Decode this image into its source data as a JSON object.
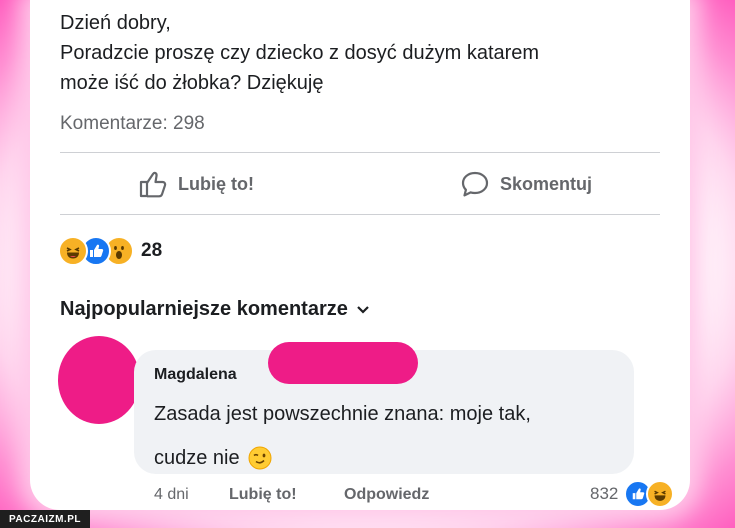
{
  "post": {
    "lines": [
      "Dzień dobry,",
      "Poradzcie proszę czy dziecko z dosyć dużym katarem",
      "może iść do żłobka? Dziękuję"
    ],
    "comments_count": "Komentarze: 298"
  },
  "actions": {
    "like_label": "Lubię to!",
    "comment_label": "Skomentuj"
  },
  "reactions": {
    "icons": [
      "haha-icon",
      "like-icon",
      "wow-icon"
    ],
    "count": "28"
  },
  "comments_section": {
    "sort_label": "Najpopularniejsze komentarze"
  },
  "comment": {
    "author": "Magdalena",
    "lines": [
      "Zasada jest powszechnie znana: moje tak,",
      "cudze nie"
    ],
    "time": "4 dni",
    "like_label": "Lubię to!",
    "reply_label": "Odpowiedz",
    "reaction_count": "832",
    "reaction_icons": [
      "like-icon",
      "haha-icon"
    ]
  },
  "watermark": "PACZAIZM.PL",
  "colors": {
    "frame_pink": "#ff5fbf",
    "redaction": "#ee1c87",
    "bubble": "#f0f2f5",
    "secondary_text": "#65676b"
  }
}
